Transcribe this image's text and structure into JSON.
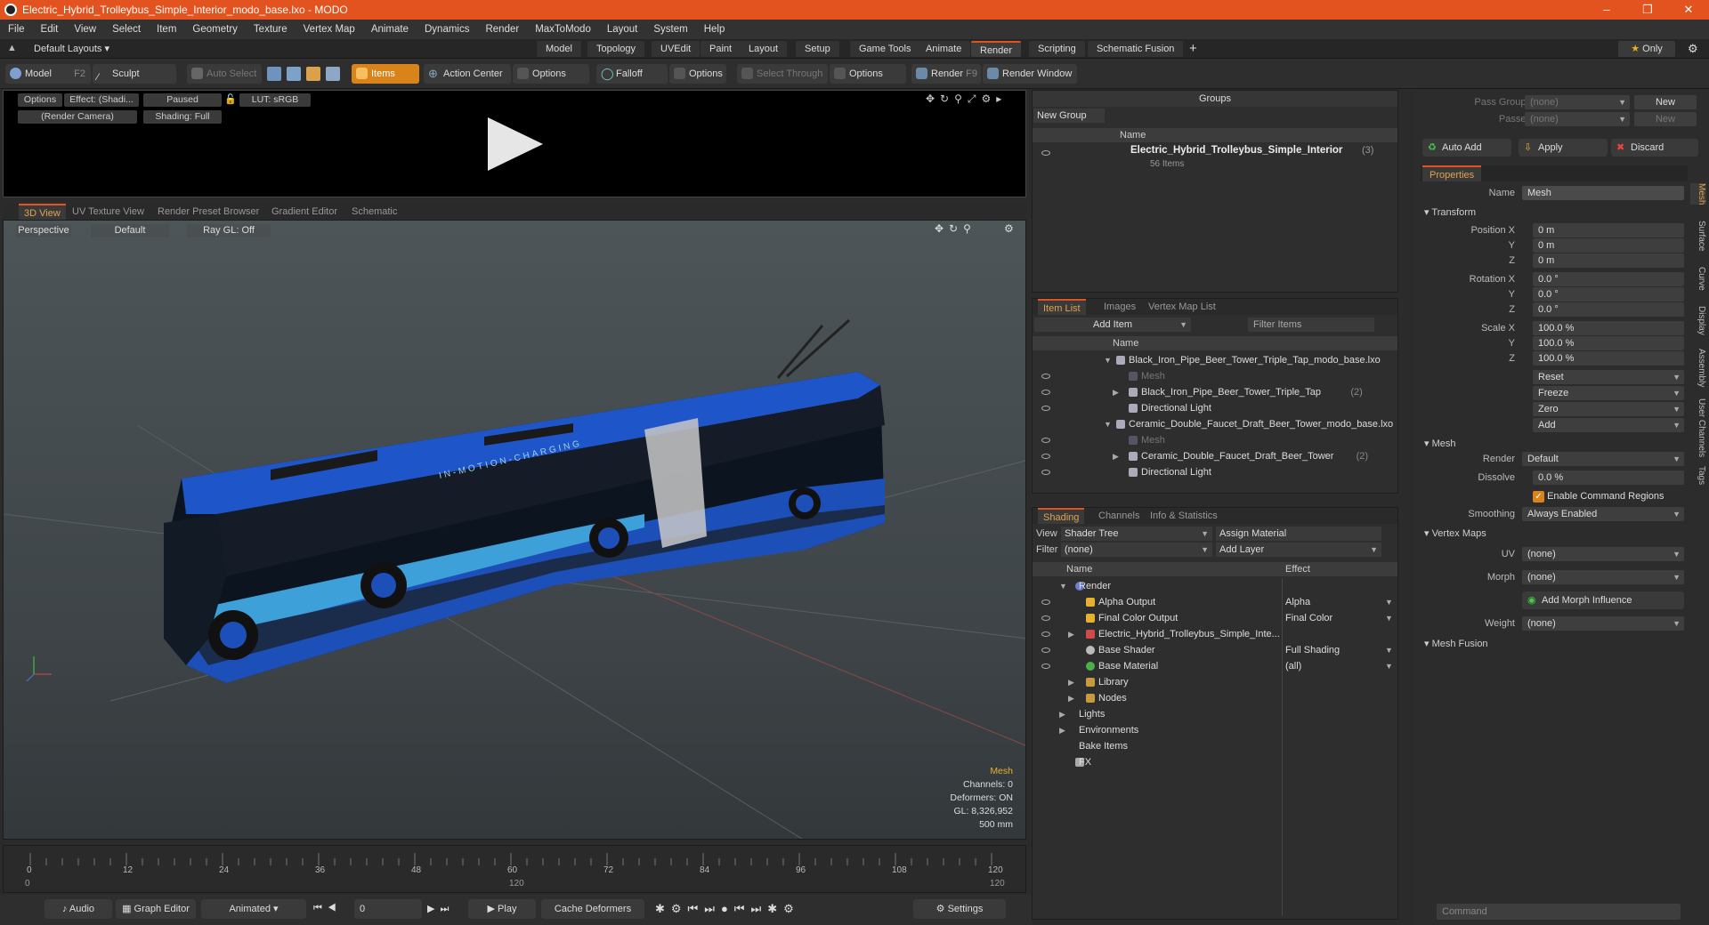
{
  "title": "Electric_Hybrid_Trolleybus_Simple_Interior_modo_base.lxo - MODO",
  "menu": [
    "File",
    "Edit",
    "View",
    "Select",
    "Item",
    "Geometry",
    "Texture",
    "Vertex Map",
    "Animate",
    "Dynamics",
    "Render",
    "MaxToModo",
    "Layout",
    "System",
    "Help"
  ],
  "layout_select": "Default Layouts",
  "layout_tabs": [
    "Model",
    "Topology",
    "UVEdit",
    "Paint",
    "Layout",
    "Setup",
    "Game Tools",
    "Animate",
    "Render",
    "Scripting",
    "Schematic Fusion"
  ],
  "active_layout_tab": "Render",
  "only_label": "Only",
  "toolbar": {
    "model": "Model",
    "model_key": "F2",
    "sculpt": "Sculpt",
    "auto_select": "Auto Select",
    "items": "Items",
    "action_center": "Action Center",
    "options1": "Options",
    "falloff": "Falloff",
    "options2": "Options",
    "select_through": "Select Through",
    "options3": "Options",
    "render": "Render",
    "render_key": "F9",
    "render_window": "Render Window"
  },
  "render_panel": {
    "options": "Options",
    "effect": "Effect: (Shadi...",
    "paused": "Paused",
    "lut": "LUT: sRGB",
    "camera": "(Render Camera)",
    "shading": "Shading: Full"
  },
  "view_tabs": [
    "3D View",
    "UV Texture View",
    "Render Preset Browser",
    "Gradient Editor",
    "Schematic"
  ],
  "viewport": {
    "perspective": "Perspective",
    "default": "Default",
    "raygl": "Ray GL: Off",
    "bus_text": "IN-MOTION-CHARGING",
    "info": {
      "type": "Mesh",
      "channels": "Channels: 0",
      "deformers": "Deformers: ON",
      "gl": "GL: 8,326,952",
      "size": "500 mm"
    }
  },
  "timeline": {
    "ticks": [
      "0",
      "12",
      "24",
      "36",
      "48",
      "60",
      "72",
      "84",
      "96",
      "108",
      "120"
    ],
    "sub_ticks": [
      "0",
      "120",
      "120"
    ]
  },
  "bottom": {
    "audio": "Audio",
    "graph_editor": "Graph Editor",
    "animated": "Animated",
    "frame": "0",
    "play": "Play",
    "cache": "Cache Deformers",
    "settings": "Settings"
  },
  "groups": {
    "title": "Groups",
    "new_group": "New Group",
    "col_name": "Name",
    "item_name": "Electric_Hybrid_Trolleybus_Simple_Interior",
    "item_count": "(3)",
    "item_sub": "56 Items"
  },
  "item_list": {
    "tabs": [
      "Item List",
      "Images",
      "Vertex Map List"
    ],
    "add_item": "Add Item",
    "filter": "Filter Items",
    "col_name": "Name",
    "rows": [
      {
        "label": "Black_Iron_Pipe_Beer_Tower_Triple_Tap_modo_base.lxo",
        "indent": 0,
        "dim": false,
        "count": ""
      },
      {
        "label": "Mesh",
        "indent": 1,
        "dim": true,
        "count": ""
      },
      {
        "label": "Black_Iron_Pipe_Beer_Tower_Triple_Tap",
        "indent": 1,
        "dim": false,
        "count": "(2)"
      },
      {
        "label": "Directional Light",
        "indent": 1,
        "dim": false,
        "count": ""
      },
      {
        "label": "Ceramic_Double_Faucet_Draft_Beer_Tower_modo_base.lxo",
        "indent": 0,
        "dim": false,
        "count": ""
      },
      {
        "label": "Mesh",
        "indent": 1,
        "dim": true,
        "count": ""
      },
      {
        "label": "Ceramic_Double_Faucet_Draft_Beer_Tower",
        "indent": 1,
        "dim": false,
        "count": "(2)"
      },
      {
        "label": "Directional Light",
        "indent": 1,
        "dim": false,
        "count": ""
      }
    ]
  },
  "shading": {
    "tabs": [
      "Shading",
      "Channels",
      "Info & Statistics"
    ],
    "view_label": "View",
    "view_value": "Shader Tree",
    "assign_material": "Assign Material",
    "filter_label": "Filter",
    "filter_value": "(none)",
    "add_layer": "Add Layer",
    "col_name": "Name",
    "col_effect": "Effect",
    "rows": [
      {
        "name": "Render",
        "effect": "",
        "indent": 0
      },
      {
        "name": "Alpha Output",
        "effect": "Alpha",
        "indent": 1
      },
      {
        "name": "Final Color Output",
        "effect": "Final Color",
        "indent": 1
      },
      {
        "name": "Electric_Hybrid_Trolleybus_Simple_Inte...",
        "effect": "",
        "indent": 1
      },
      {
        "name": "Base Shader",
        "effect": "Full Shading",
        "indent": 1
      },
      {
        "name": "Base Material",
        "effect": "(all)",
        "indent": 1
      },
      {
        "name": "Library",
        "effect": "",
        "indent": 1
      },
      {
        "name": "Nodes",
        "effect": "",
        "indent": 1
      },
      {
        "name": "Lights",
        "effect": "",
        "indent": 0
      },
      {
        "name": "Environments",
        "effect": "",
        "indent": 0
      },
      {
        "name": "Bake Items",
        "effect": "",
        "indent": 0
      },
      {
        "name": "FX",
        "effect": "",
        "indent": 0
      }
    ]
  },
  "props": {
    "pass_groups": "Pass Groups",
    "passes": "Passes",
    "none": "(none)",
    "new": "New",
    "auto_add": "Auto Add",
    "apply": "Apply",
    "discard": "Discard",
    "tab": "Properties",
    "name_label": "Name",
    "name_value": "Mesh",
    "transform": "Transform",
    "pos_x": "Position X",
    "y": "Y",
    "z": "Z",
    "pos_vals": [
      "0 m",
      "0 m",
      "0 m"
    ],
    "rot_x": "Rotation X",
    "rot_vals": [
      "0.0 °",
      "0.0 °",
      "0.0 °"
    ],
    "scale_x": "Scale X",
    "scale_vals": [
      "100.0 %",
      "100.0 %",
      "100.0 %"
    ],
    "reset": "Reset",
    "freeze": "Freeze",
    "zero": "Zero",
    "add": "Add",
    "mesh": "Mesh",
    "render_label": "Render",
    "render_value": "Default",
    "dissolve_label": "Dissolve",
    "dissolve_value": "0.0 %",
    "enable_cmd": "Enable Command Regions",
    "smoothing_label": "Smoothing",
    "smoothing_value": "Always Enabled",
    "vertex_maps": "Vertex Maps",
    "uv_label": "UV",
    "morph_label": "Morph",
    "add_morph": "Add Morph Influence",
    "weight_label": "Weight",
    "mesh_fusion": "Mesh Fusion",
    "command": "Command",
    "side_tabs": [
      "Mesh",
      "Surface",
      "Curve",
      "Display",
      "Assembly",
      "User Channels",
      "Tags"
    ]
  },
  "colors": {
    "accent": "#e2531f",
    "active_tab": "#d8841a"
  }
}
